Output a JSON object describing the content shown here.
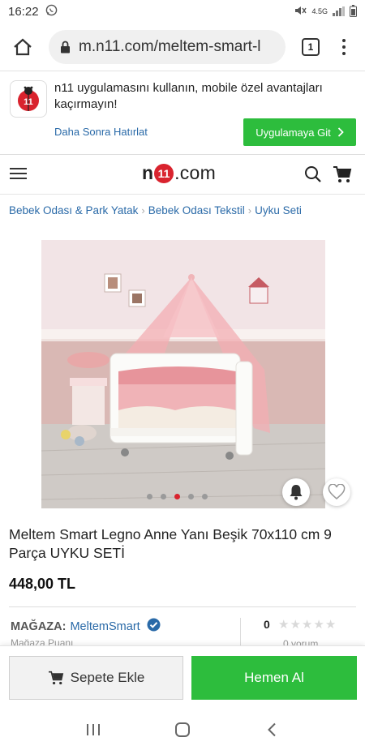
{
  "status_bar": {
    "time": "16:22",
    "network": "4.5G"
  },
  "browser": {
    "url": "m.n11.com/meltem-smart-l",
    "tab_count": "1"
  },
  "app_banner": {
    "message": "n11 uygulamasını kullanın, mobile özel avantajları kaçırmayın!",
    "later_label": "Daha Sonra Hatırlat",
    "go_label": "Uygulamaya Git",
    "accent": "#2dbd3d"
  },
  "header": {
    "logo_prefix": "n",
    "logo_mid": "11",
    "logo_suffix": ".com"
  },
  "breadcrumb": [
    "Bebek Odası & Park Yatak",
    "Bebek Odası Tekstil",
    "Uyku Seti"
  ],
  "product": {
    "title": "Meltem Smart Legno Anne Yanı Beşik 70x110 cm 9 Parça UYKU SETİ",
    "price": "448,00 TL",
    "gallery": {
      "image_count": 5,
      "active_index": 2
    }
  },
  "store": {
    "label": "MAĞAZA:",
    "name": "MeltemSmart",
    "score_label": "Mağaza Puanı",
    "review_count": "0",
    "review_label": "0 yorum",
    "rating_stars": 0
  },
  "actions": {
    "add_to_cart": "Sepete Ekle",
    "buy_now": "Hemen Al"
  },
  "colors": {
    "brand_red": "#d9232e",
    "link_blue": "#2a6aa8",
    "green": "#2dbd3d"
  }
}
